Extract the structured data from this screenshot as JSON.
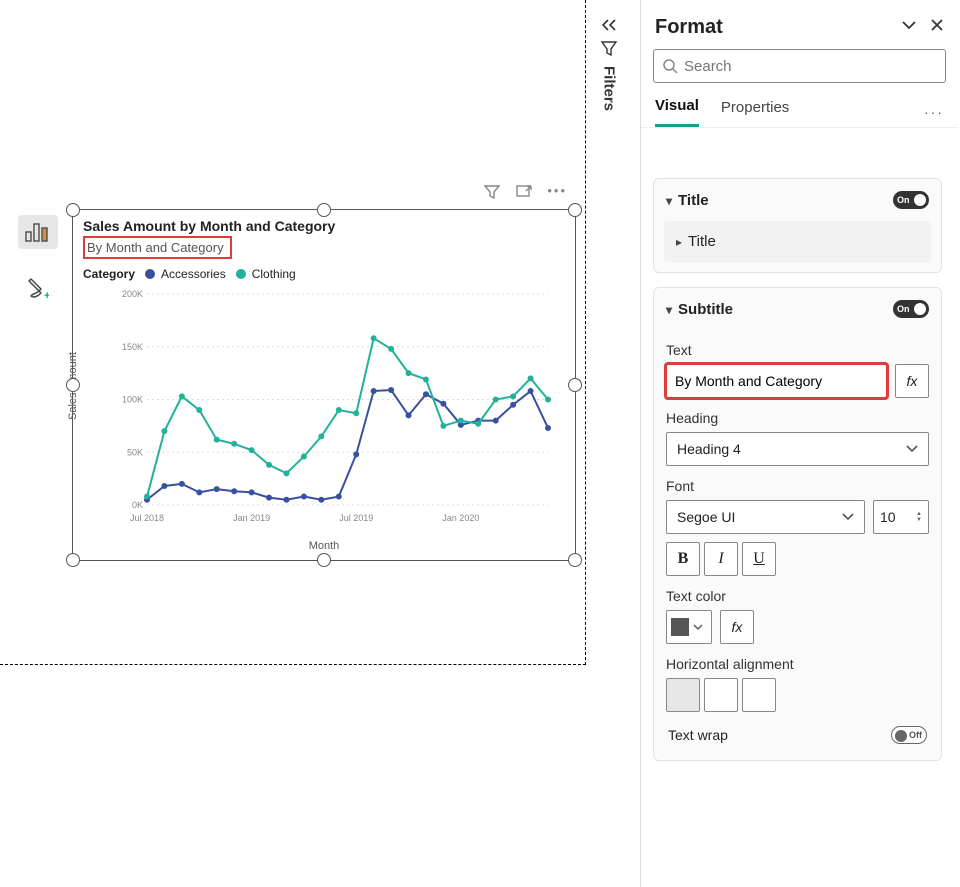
{
  "canvas": {
    "side_tabs": [
      "bar-chart-icon",
      "paintbrush-icon"
    ]
  },
  "chart": {
    "toolbar": [
      "filter-icon",
      "focus-icon",
      "more-icon"
    ],
    "title": "Sales Amount by Month and Category",
    "subtitle": "By Month and Category",
    "legend_label": "Category",
    "y_axis_title": "Sales Amount",
    "x_axis_title": "Month"
  },
  "chart_data": {
    "type": "line",
    "xlabel": "Month",
    "ylabel": "Sales Amount",
    "ylim": [
      0,
      200000
    ],
    "y_ticks": [
      0,
      50000,
      100000,
      150000,
      200000
    ],
    "y_tick_labels": [
      "0K",
      "50K",
      "100K",
      "150K",
      "200K"
    ],
    "x_tick_labels": [
      "Jul 2018",
      "Jan 2019",
      "Jul 2019",
      "Jan 2020"
    ],
    "title": "Sales Amount by Month and Category",
    "series": [
      {
        "name": "Accessories",
        "color": "#3950a0",
        "values": [
          5000,
          18000,
          20000,
          12000,
          15000,
          13000,
          12000,
          7000,
          5000,
          8000,
          5000,
          8000,
          48000,
          108000,
          109000,
          85000,
          105000,
          96000,
          76000,
          80000,
          80000,
          95000,
          108000,
          73000
        ]
      },
      {
        "name": "Clothing",
        "color": "#21b299",
        "values": [
          8000,
          70000,
          103000,
          90000,
          62000,
          58000,
          52000,
          38000,
          30000,
          46000,
          65000,
          90000,
          87000,
          158000,
          148000,
          125000,
          119000,
          75000,
          80000,
          77000,
          100000,
          103000,
          120000,
          100000
        ]
      }
    ]
  },
  "filters": {
    "label": "Filters"
  },
  "format": {
    "title": "Format",
    "search_placeholder": "Search",
    "tabs": {
      "visual": "Visual",
      "properties": "Properties"
    },
    "sections": {
      "title": {
        "label": "Title",
        "state": "On",
        "sub_label": "Title"
      },
      "subtitle": {
        "label": "Subtitle",
        "state": "On",
        "text_label": "Text",
        "text_value": "By Month and Category",
        "heading_label": "Heading",
        "heading_value": "Heading 4",
        "font_label": "Font",
        "font_value": "Segoe UI",
        "font_size": "10",
        "bold": "B",
        "italic": "I",
        "underline": "U",
        "text_color_label": "Text color",
        "text_color": "#555555",
        "align_label": "Horizontal alignment",
        "text_wrap_label": "Text wrap",
        "text_wrap_state": "Off"
      }
    },
    "fx_label": "fx"
  }
}
